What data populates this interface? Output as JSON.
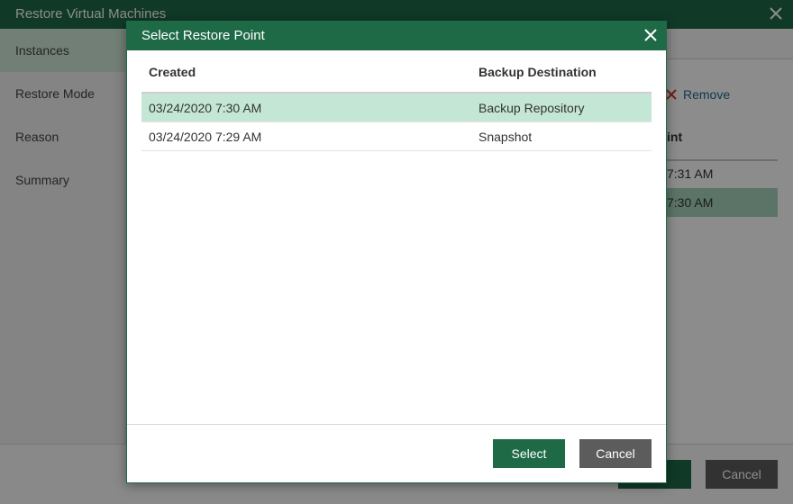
{
  "background": {
    "title": "Restore Virtual Machines",
    "nav": [
      "Instances",
      "Restore Mode",
      "Reason",
      "Summary"
    ],
    "active_nav": 0,
    "remove_label": "Remove",
    "column_header_fragment": "int",
    "rows": [
      "7:31 AM",
      "7:30 AM"
    ],
    "selected_row": 1,
    "cancel_label": "Cancel"
  },
  "modal": {
    "title": "Select Restore Point",
    "columns": [
      "Created",
      "Backup Destination"
    ],
    "rows": [
      {
        "created": "03/24/2020 7:30 AM",
        "destination": "Backup Repository",
        "selected": true
      },
      {
        "created": "03/24/2020 7:29 AM",
        "destination": "Snapshot",
        "selected": false
      }
    ],
    "select_label": "Select",
    "cancel_label": "Cancel"
  },
  "colors": {
    "brand_green": "#1e6a47",
    "selected_row": "#c4e7d5",
    "cancel_gray": "#5c5c5c",
    "remove_red": "#d9342b"
  }
}
